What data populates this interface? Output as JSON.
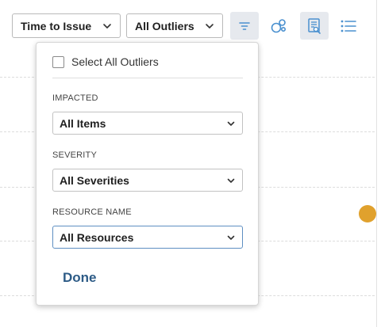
{
  "toolbar": {
    "metric_select": {
      "value": "Time to Issue"
    },
    "outlier_select": {
      "value": "All Outliers"
    },
    "buttons": [
      {
        "icon": "filter-icon",
        "active": true
      },
      {
        "icon": "bubbles-icon",
        "active": false
      },
      {
        "icon": "report-icon",
        "active": true
      },
      {
        "icon": "list-icon",
        "active": false
      }
    ]
  },
  "filter_panel": {
    "select_all_label": "Select All Outliers",
    "select_all_checked": false,
    "impacted": {
      "label": "IMPACTED",
      "value": "All Items"
    },
    "severity": {
      "label": "SEVERITY",
      "value": "All Severities"
    },
    "resource_name": {
      "label": "RESOURCE NAME",
      "value": "All Resources"
    },
    "done_label": "Done"
  },
  "colors": {
    "accent": "#4a90cf",
    "active_button_bg": "#e6e9ee",
    "done_text": "#2d5b86",
    "outlier_dot": "#e0a12d",
    "focus_border": "#5e8fc2"
  }
}
